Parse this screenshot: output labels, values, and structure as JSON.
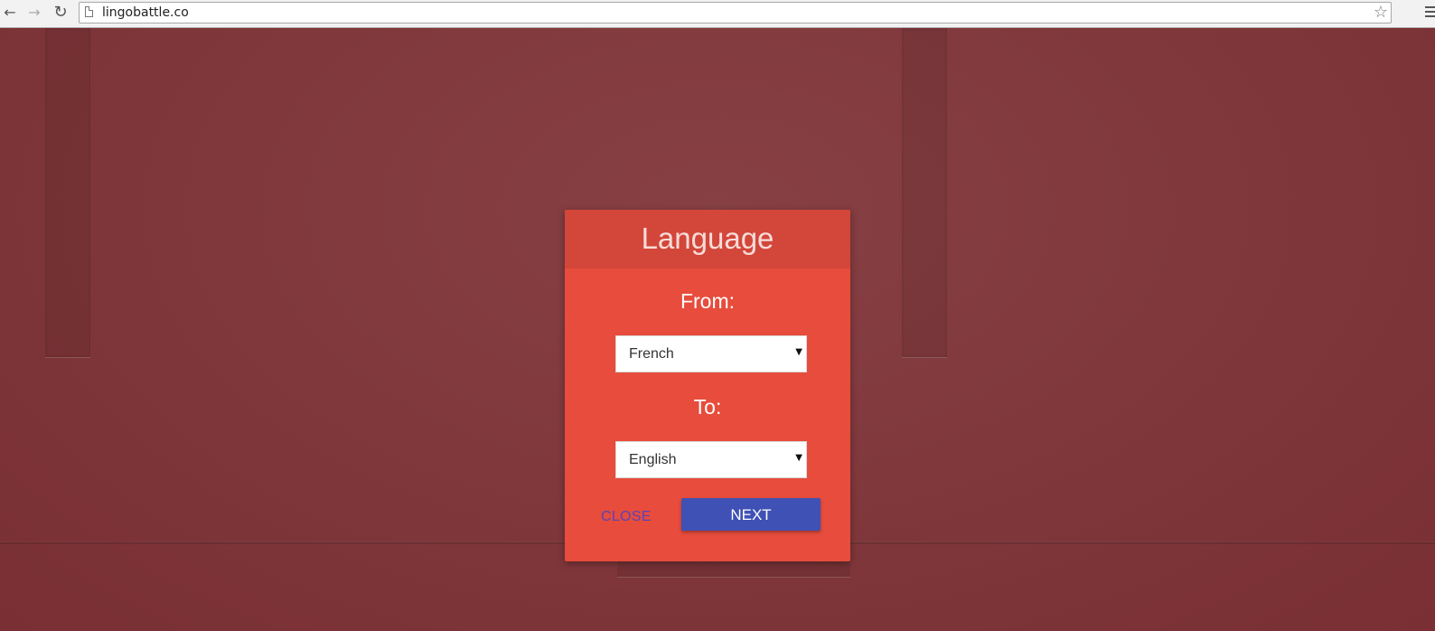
{
  "browser": {
    "url": "lingobattle.co"
  },
  "dialog": {
    "title": "Language",
    "from_label": "From:",
    "from_value": "French",
    "to_label": "To:",
    "to_value": "English",
    "close_label": "CLOSE",
    "next_label": "NEXT"
  },
  "colors": {
    "background": "#7e3438",
    "dialog": "#e74c3c",
    "dialog_header": "#d3463a",
    "next_button": "#3f51b5",
    "close_text": "#5a44b8"
  }
}
